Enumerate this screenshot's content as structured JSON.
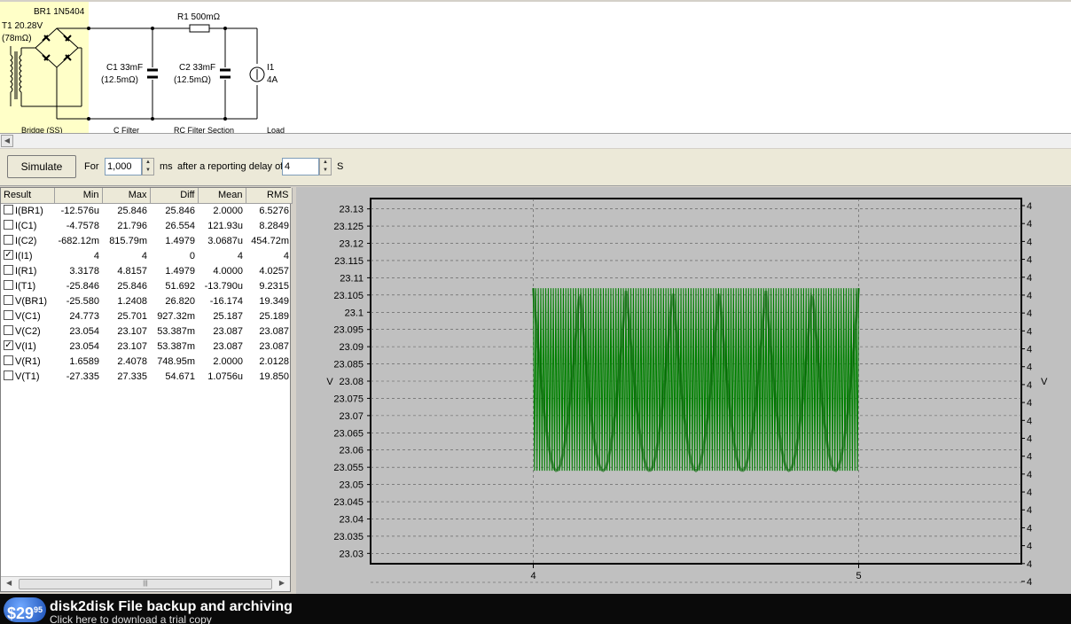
{
  "schematic": {
    "components": {
      "bridge": "BR1 1N5404",
      "transformer_line1": "T1 20.28V",
      "transformer_line2": "(78mΩ)",
      "c1_line1": "C1 33mF",
      "c1_line2": "(12.5mΩ)",
      "r1": "R1 500mΩ",
      "c2_line1": "C2 33mF",
      "c2_line2": "(12.5mΩ)",
      "i1_line1": "I1",
      "i1_line2": "4A"
    },
    "sections": [
      "Bridge (SS)",
      "C Filter",
      "RC Filter Section",
      "Load"
    ],
    "highlight_color": "#ffffc8"
  },
  "toolbar": {
    "simulate_label": "Simulate",
    "for_label": "For",
    "duration_value": "1,000",
    "duration_unit": "ms",
    "delay_label": "after a reporting delay of",
    "delay_value": "4",
    "delay_unit": "S"
  },
  "results": {
    "headers": [
      "Result",
      "Min",
      "Max",
      "Diff",
      "Mean",
      "RMS"
    ],
    "rows": [
      {
        "name": "I(BR1)",
        "checked": false,
        "min": "-12.576u",
        "max": "25.846",
        "diff": "25.846",
        "mean": "2.0000",
        "rms": "6.5276"
      },
      {
        "name": "I(C1)",
        "checked": false,
        "min": "-4.7578",
        "max": "21.796",
        "diff": "26.554",
        "mean": "121.93u",
        "rms": "8.2849"
      },
      {
        "name": "I(C2)",
        "checked": false,
        "min": "-682.12m",
        "max": "815.79m",
        "diff": "1.4979",
        "mean": "3.0687u",
        "rms": "454.72m"
      },
      {
        "name": "I(I1)",
        "checked": true,
        "min": "4",
        "max": "4",
        "diff": "0",
        "mean": "4",
        "rms": "4"
      },
      {
        "name": "I(R1)",
        "checked": false,
        "min": "3.3178",
        "max": "4.8157",
        "diff": "1.4979",
        "mean": "4.0000",
        "rms": "4.0257"
      },
      {
        "name": "I(T1)",
        "checked": false,
        "min": "-25.846",
        "max": "25.846",
        "diff": "51.692",
        "mean": "-13.790u",
        "rms": "9.2315"
      },
      {
        "name": "V(BR1)",
        "checked": false,
        "min": "-25.580",
        "max": "1.2408",
        "diff": "26.820",
        "mean": "-16.174",
        "rms": "19.349"
      },
      {
        "name": "V(C1)",
        "checked": false,
        "min": "24.773",
        "max": "25.701",
        "diff": "927.32m",
        "mean": "25.187",
        "rms": "25.189"
      },
      {
        "name": "V(C2)",
        "checked": false,
        "min": "23.054",
        "max": "23.107",
        "diff": "53.387m",
        "mean": "23.087",
        "rms": "23.087"
      },
      {
        "name": "V(I1)",
        "checked": true,
        "min": "23.054",
        "max": "23.107",
        "diff": "53.387m",
        "mean": "23.087",
        "rms": "23.087"
      },
      {
        "name": "V(R1)",
        "checked": false,
        "min": "1.6589",
        "max": "2.4078",
        "diff": "748.95m",
        "mean": "2.0000",
        "rms": "2.0128"
      },
      {
        "name": "V(T1)",
        "checked": false,
        "min": "-27.335",
        "max": "27.335",
        "diff": "54.671",
        "mean": "1.0756u",
        "rms": "19.850"
      }
    ]
  },
  "chart_data": {
    "type": "line",
    "title": "",
    "xlabel": "",
    "ylabel": "V",
    "y2label": "V",
    "xlim": [
      3.5,
      5.5
    ],
    "ylim": [
      23.027,
      23.133
    ],
    "x_ticks": [
      "4",
      "5"
    ],
    "y_ticks": [
      "23.13",
      "23.125",
      "23.12",
      "23.115",
      "23.11",
      "23.105",
      "23.1",
      "23.095",
      "23.09",
      "23.085",
      "23.08",
      "23.075",
      "23.07",
      "23.065",
      "23.06",
      "23.055",
      "23.05",
      "23.045",
      "23.04",
      "23.035",
      "23.03"
    ],
    "y2_ticks": [
      "4",
      "4",
      "4",
      "4",
      "4",
      "4",
      "4",
      "4",
      "4",
      "4",
      "4",
      "4",
      "4",
      "4",
      "4",
      "4",
      "4",
      "4",
      "4",
      "4",
      "4",
      "4"
    ],
    "grid": true,
    "series": [
      {
        "color": "#008000",
        "x_start": 4,
        "x_end": 5,
        "min": 23.054,
        "max": 23.107,
        "ripple_cycles": 7
      }
    ]
  },
  "ad": {
    "price": "$29",
    "price_cents": "95",
    "title": "disk2disk File backup and archiving",
    "subtitle": "Click here to download a trial copy"
  }
}
